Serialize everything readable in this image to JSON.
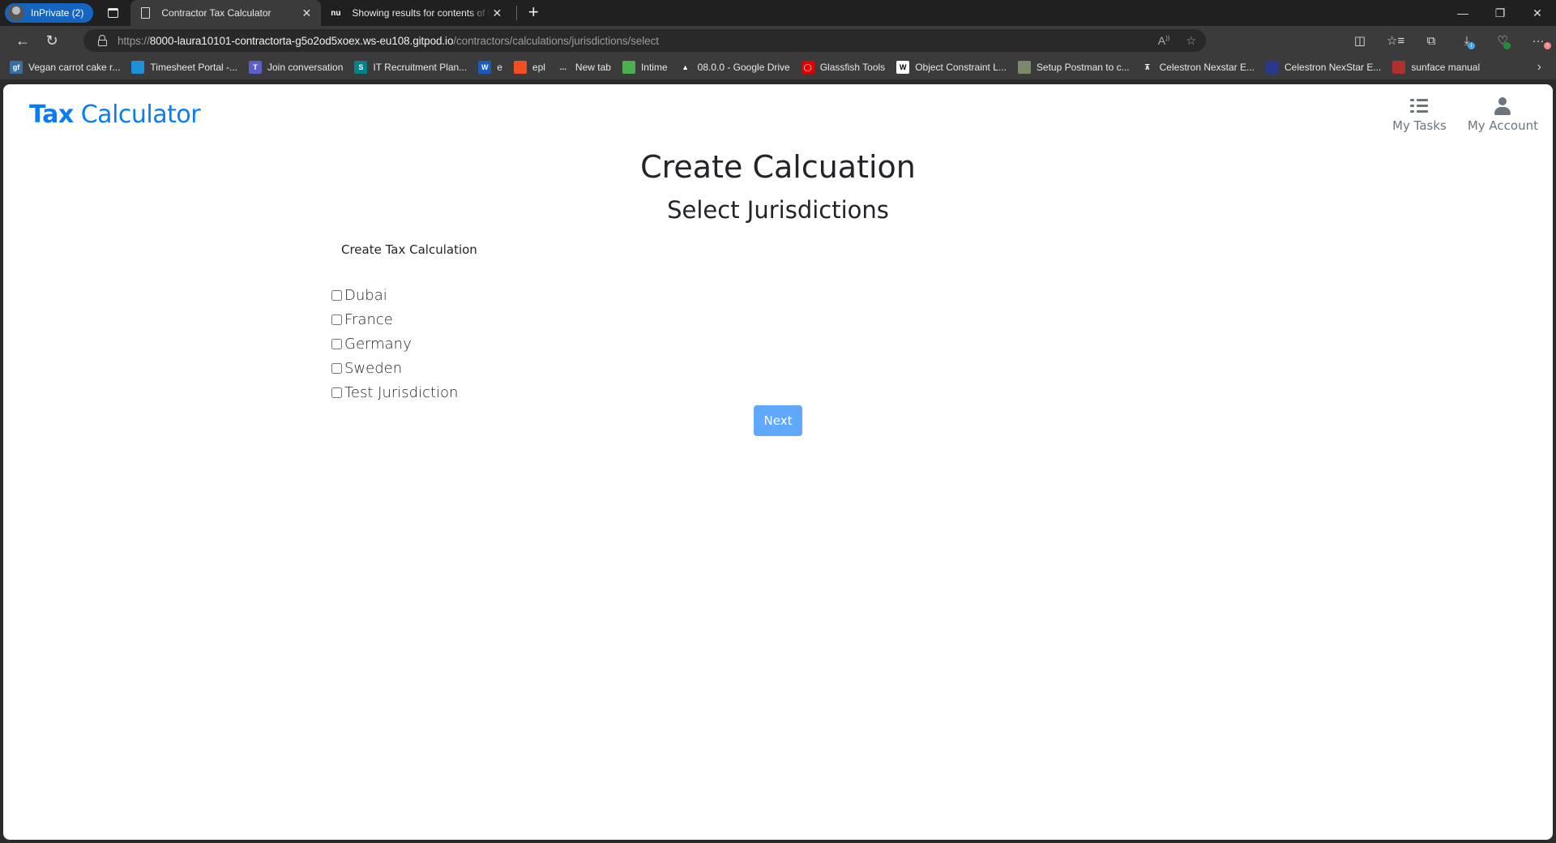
{
  "browser": {
    "inprivate_label": "InPrivate (2)",
    "tabs": [
      {
        "title": "Contractor Tax Calculator",
        "icon": "document-icon",
        "active": true
      },
      {
        "title": "Showing results for contents of t",
        "icon": "nu-icon",
        "active": false
      }
    ],
    "new_tab_symbol": "+",
    "close_symbol": "✕",
    "window_controls": {
      "minimize": "—",
      "restore": "❐",
      "close": "✕"
    },
    "url": {
      "scheme": "https://",
      "host": "8000-laura10101-contractorta-g5o2od5xoex.ws-eu108.gitpod.io",
      "path": "/contractors/calculations/jurisdictions/select"
    },
    "bookmarks": [
      {
        "label": "Vegan carrot cake r...",
        "icon_text": "gf",
        "color": "#3a6ea5"
      },
      {
        "label": "Timesheet Portal -...",
        "icon_text": "",
        "color": "#1e90d8"
      },
      {
        "label": "Join conversation",
        "icon_text": "T",
        "color": "#5b5fc7"
      },
      {
        "label": "IT Recruitment Plan...",
        "icon_text": "S",
        "color": "#038387"
      },
      {
        "label": "e",
        "icon_text": "W",
        "color": "#185abd"
      },
      {
        "label": "epl",
        "icon_text": "",
        "color": "#f25022"
      },
      {
        "label": "New tab",
        "icon_text": "…",
        "color": "#3b3b3b"
      },
      {
        "label": "Intime",
        "icon_text": "",
        "color": "#4caf50"
      },
      {
        "label": "08.0.0 - Google Drive",
        "icon_text": "▲",
        "color": "#3b3b3b"
      },
      {
        "label": "Glassfish Tools",
        "icon_text": "◯",
        "color": "#e00000"
      },
      {
        "label": "Object Constraint L...",
        "icon_text": "W",
        "color": "#ffffff"
      },
      {
        "label": "Setup Postman to c...",
        "icon_text": "",
        "color": "#7a8a6a"
      },
      {
        "label": "Celestron Nexstar E...",
        "icon_text": "⊼",
        "color": "#3b3b3b"
      },
      {
        "label": "Celestron NexStar E...",
        "icon_text": "",
        "color": "#2a3a8a"
      },
      {
        "label": "sunface manual",
        "icon_text": "",
        "color": "#b03030"
      }
    ]
  },
  "app": {
    "brand_bold": "Tax",
    "brand_rest": " Calculator",
    "nav": [
      {
        "label": "My Tasks",
        "icon": "tasks-list-icon"
      },
      {
        "label": "My Account",
        "icon": "user-icon"
      }
    ],
    "page_title": "Create Calcuation",
    "page_subtitle": "Select Jurisdictions",
    "form_label": "Create Tax Calculation",
    "jurisdictions": [
      {
        "label": "Dubai",
        "checked": false
      },
      {
        "label": "France",
        "checked": false
      },
      {
        "label": "Germany",
        "checked": false
      },
      {
        "label": "Sweden",
        "checked": false
      },
      {
        "label": "Test Jurisdiction",
        "checked": false
      }
    ],
    "next_label": "Next",
    "accent_color": "#0a7cf5",
    "button_color": "#60a8fd"
  }
}
